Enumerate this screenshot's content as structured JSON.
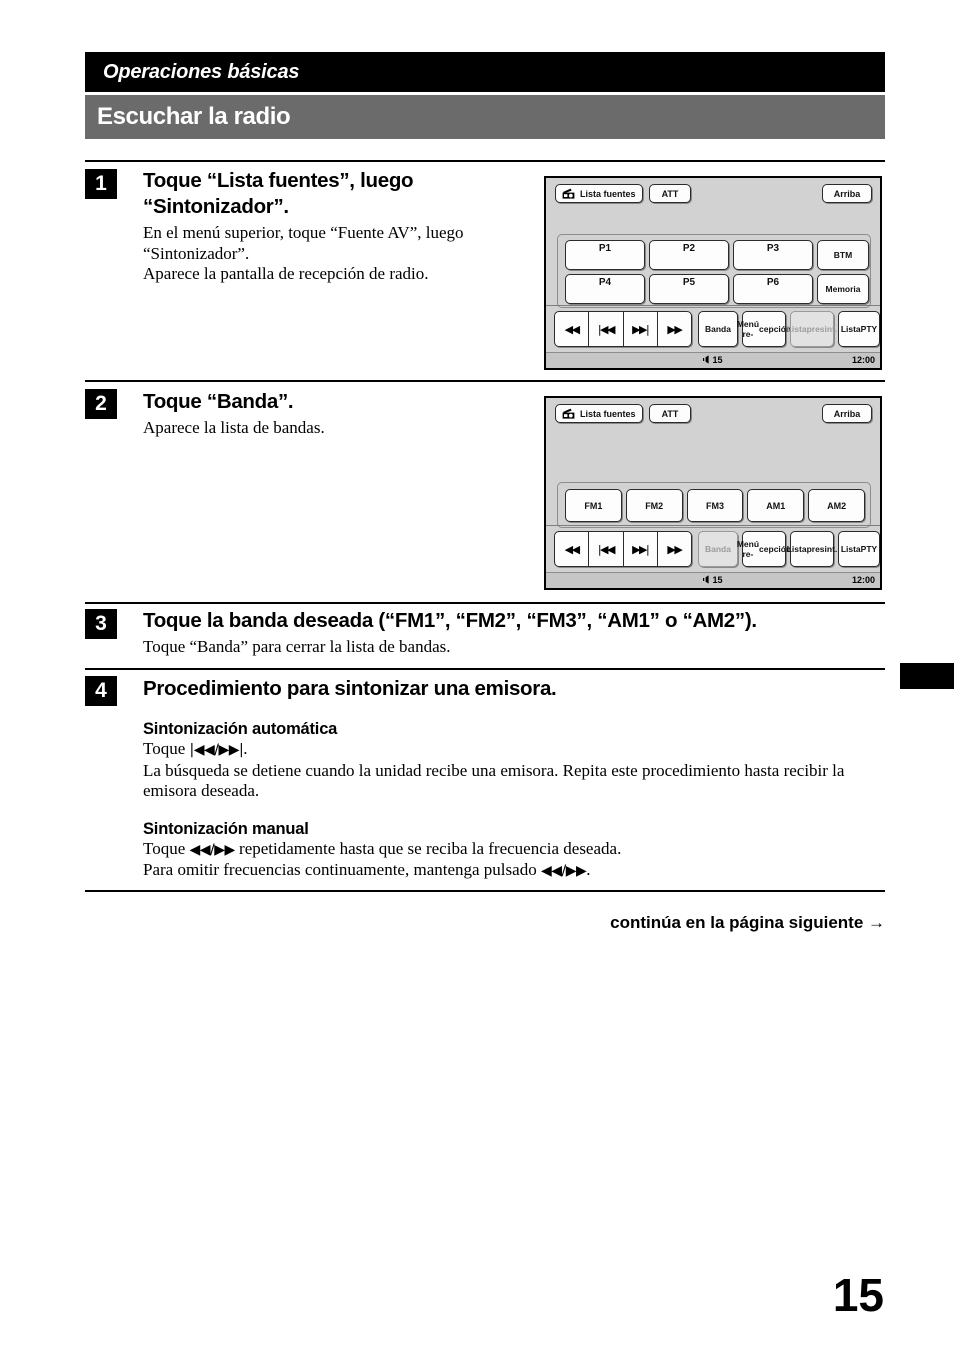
{
  "header": {
    "chapter": "Operaciones básicas",
    "title": "Escuchar la radio"
  },
  "steps": [
    {
      "number": "1",
      "heading": "Toque “Lista fuentes”, luego “Sintonizador”.",
      "body_line1": "En el menú superior, toque “Fuente AV”, luego “Sintonizador”.",
      "body_line2": "Aparece la pantalla de recepción de radio."
    },
    {
      "number": "2",
      "heading": "Toque “Banda”.",
      "body_line1": "Aparece la lista de bandas."
    },
    {
      "number": "3",
      "heading": "Toque la banda deseada (“FM1”, “FM2”, “FM3”, “AM1” o “AM2”).",
      "body_line1": "Toque “Banda” para cerrar la lista de bandas."
    },
    {
      "number": "4",
      "heading": "Procedimiento para sintonizar una emisora.",
      "sections": [
        {
          "title": "Sintonización automática",
          "line1_prefix": "Toque ",
          "line1_glyph": "|◀◀/▶▶|",
          "line1_suffix": ".",
          "line2": "La búsqueda se detiene cuando la unidad recibe una emisora. Repita este procedimiento hasta recibir la emisora deseada."
        },
        {
          "title": "Sintonización manual",
          "line1_prefix": "Toque ",
          "line1_glyph": "◀◀/▶▶",
          "line1_suffix": " repetidamente hasta que se reciba la frecuencia deseada.",
          "line2_prefix": "Para omitir frecuencias continuamente, mantenga pulsado ",
          "line2_glyph": "◀◀/▶▶",
          "line2_suffix": "."
        }
      ]
    }
  ],
  "footer": {
    "continues": "continúa en la página siguiente →",
    "page_number": "15"
  },
  "screen1": {
    "source_button": "Lista fuentes",
    "source_icon": "radio-icon",
    "att_button": "ATT",
    "up_button": "Arriba",
    "presets": [
      {
        "label": "P1"
      },
      {
        "label": "P2"
      },
      {
        "label": "P3"
      },
      {
        "label": "BTM"
      },
      {
        "label": "P4"
      },
      {
        "label": "P5"
      },
      {
        "label": "P6"
      },
      {
        "label": "Memoria"
      }
    ],
    "transport": [
      {
        "glyph": "◀◀",
        "name": "rewind"
      },
      {
        "glyph": "|◀◀",
        "name": "seek-back"
      },
      {
        "glyph": "▶▶|",
        "name": "seek-forward"
      },
      {
        "glyph": "▶▶",
        "name": "fast-forward"
      }
    ],
    "functions": [
      {
        "label": "Banda",
        "dimmed": false
      },
      {
        "label": "Menú re-cepción",
        "line1": "Menú re-",
        "line2": "cepción",
        "dimmed": false
      },
      {
        "label": "Lista presint.",
        "line1": "Lista",
        "line2": "presint.",
        "dimmed": true
      },
      {
        "label": "Lista PTY",
        "line1": "Lista",
        "line2": "PTY",
        "dimmed": false
      }
    ],
    "status": {
      "volume": "15",
      "clock": "12:00"
    }
  },
  "screen2": {
    "source_button": "Lista fuentes",
    "source_icon": "radio-icon",
    "att_button": "ATT",
    "up_button": "Arriba",
    "bands": [
      {
        "label": "FM1"
      },
      {
        "label": "FM2"
      },
      {
        "label": "FM3"
      },
      {
        "label": "AM1"
      },
      {
        "label": "AM2"
      }
    ],
    "transport": [
      {
        "glyph": "◀◀",
        "name": "rewind"
      },
      {
        "glyph": "|◀◀",
        "name": "seek-back"
      },
      {
        "glyph": "▶▶|",
        "name": "seek-forward"
      },
      {
        "glyph": "▶▶",
        "name": "fast-forward"
      }
    ],
    "functions": [
      {
        "label": "Banda",
        "dimmed": true
      },
      {
        "label": "Menú re-cepción",
        "line1": "Menú re-",
        "line2": "cepción",
        "dimmed": false
      },
      {
        "label": "Lista presint.",
        "line1": "Lista",
        "line2": "presint.",
        "dimmed": false
      },
      {
        "label": "Lista PTY",
        "line1": "Lista",
        "line2": "PTY",
        "dimmed": false
      }
    ],
    "status": {
      "volume": "15",
      "clock": "12:00"
    }
  },
  "colors": {
    "chapter_bar": "#000000",
    "title_bar": "#6b6b6b",
    "screen_bg": "#d2d2d2",
    "button_bg": "#fdfdfd",
    "dim_text": "#9c9c9c"
  }
}
